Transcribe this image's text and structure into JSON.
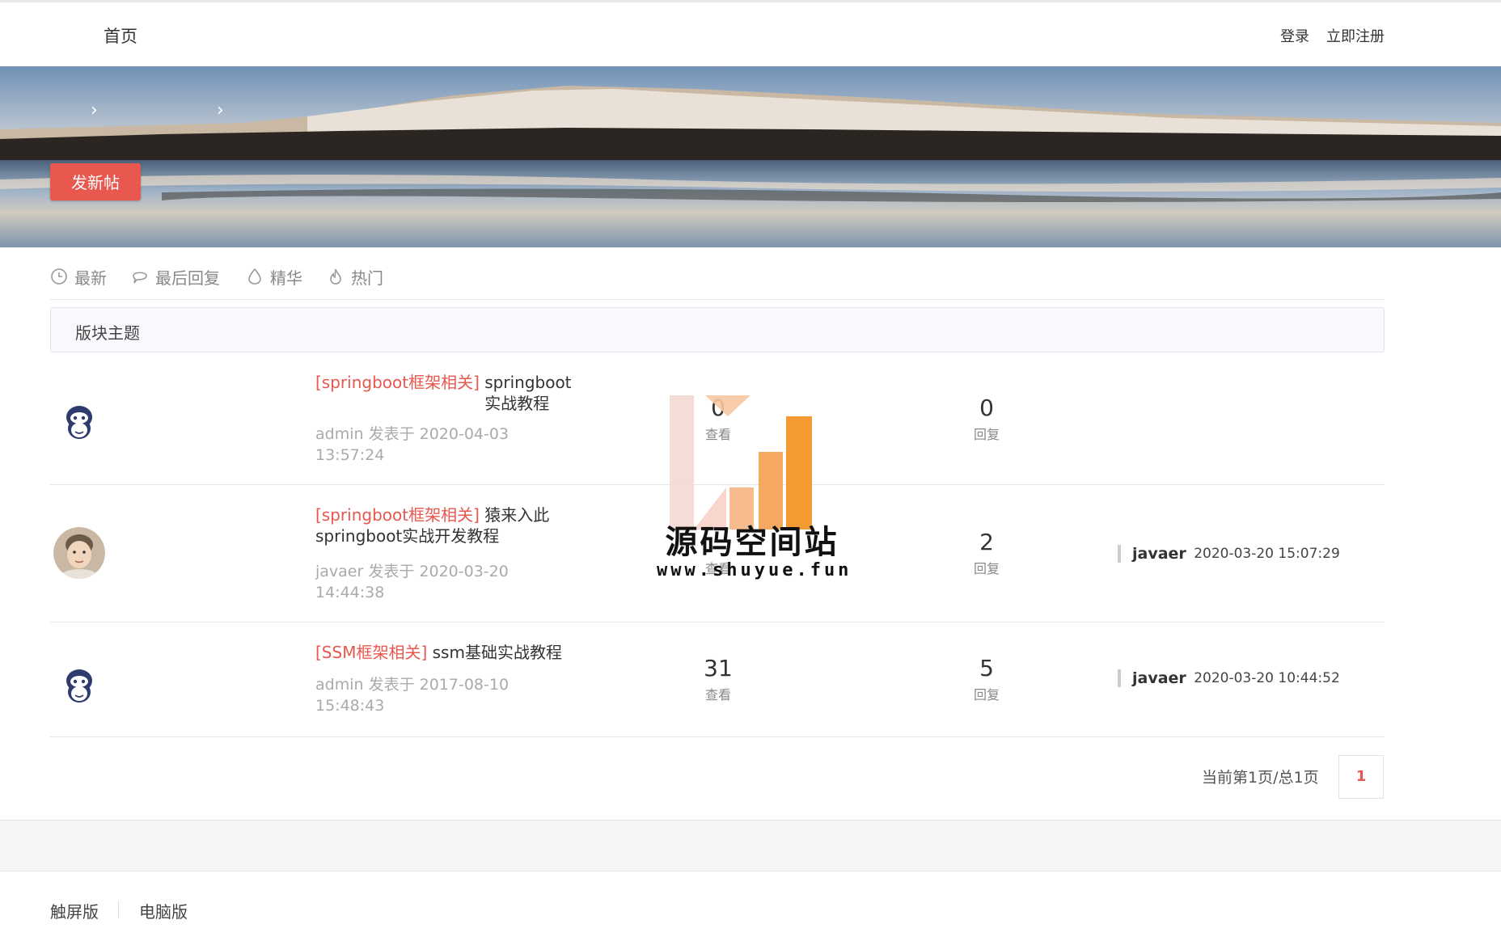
{
  "header": {
    "home_label": "首页",
    "login_label": "登录",
    "register_label": "立即注册"
  },
  "banner": {
    "new_post_label": "发新帖",
    "breadcrumb_sep": "›"
  },
  "filters": [
    {
      "label": "最新",
      "icon": "clock-icon"
    },
    {
      "label": "最后回复",
      "icon": "comment-icon"
    },
    {
      "label": "精华",
      "icon": "drop-icon"
    },
    {
      "label": "热门",
      "icon": "flame-icon"
    }
  ],
  "section": {
    "title": "版块主题"
  },
  "threads": [
    {
      "avatar": "monkey-avatar",
      "category": "[springboot框架相关]",
      "title_line1": "springboot",
      "title_line2": "实战教程",
      "author": "admin",
      "posted_text": "发表于 2020-04-03",
      "posted_time": "13:57:24",
      "views": "0",
      "views_label": "查看",
      "replies": "0",
      "replies_label": "回复",
      "last_user": "",
      "last_time": ""
    },
    {
      "avatar": "photo-avatar",
      "category": "[springboot框架相关]",
      "title_line1": "猿来入此",
      "title_line2": "springboot实战开发教程",
      "author": "javaer",
      "posted_text": "发表于 2020-03-20",
      "posted_time": "14:44:38",
      "views": "",
      "views_label": "查看",
      "replies": "2",
      "replies_label": "回复",
      "last_user": "javaer",
      "last_time": "2020-03-20 15:07:29"
    },
    {
      "avatar": "monkey-avatar",
      "category": "[SSM框架相关]",
      "title_line1": "ssm基础实战教程",
      "title_line2": "",
      "author": "admin",
      "posted_text": "发表于 2017-08-10",
      "posted_time": "15:48:43",
      "views": "31",
      "views_label": "查看",
      "replies": "5",
      "replies_label": "回复",
      "last_user": "javaer",
      "last_time": "2020-03-20 10:44:52"
    }
  ],
  "pagination": {
    "summary": "当前第1页/总1页",
    "current": "1"
  },
  "footer": {
    "touch_label": "触屏版",
    "pc_label": "电脑版"
  },
  "watermark": {
    "title": "源码空间站",
    "url": "www.shuyue.fun"
  },
  "colors": {
    "accent": "#e8584e",
    "watermark_orange": "#f39a33"
  }
}
